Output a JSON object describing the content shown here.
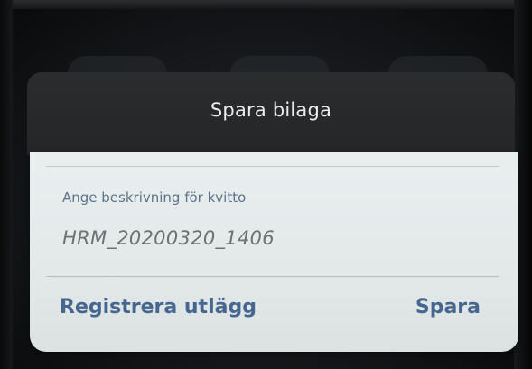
{
  "dialog": {
    "title": "Spara bilaga",
    "field_label": "Ange beskrivning för kvitto",
    "field_value": "HRM_20200320_1406",
    "secondary_action": "Registrera utlägg",
    "primary_action": "Spara"
  },
  "colors": {
    "action_blue": "#44668f",
    "label_blue": "#5e7389",
    "dialog_header": "#2a2c2e",
    "dialog_body": "#e9eeef"
  }
}
